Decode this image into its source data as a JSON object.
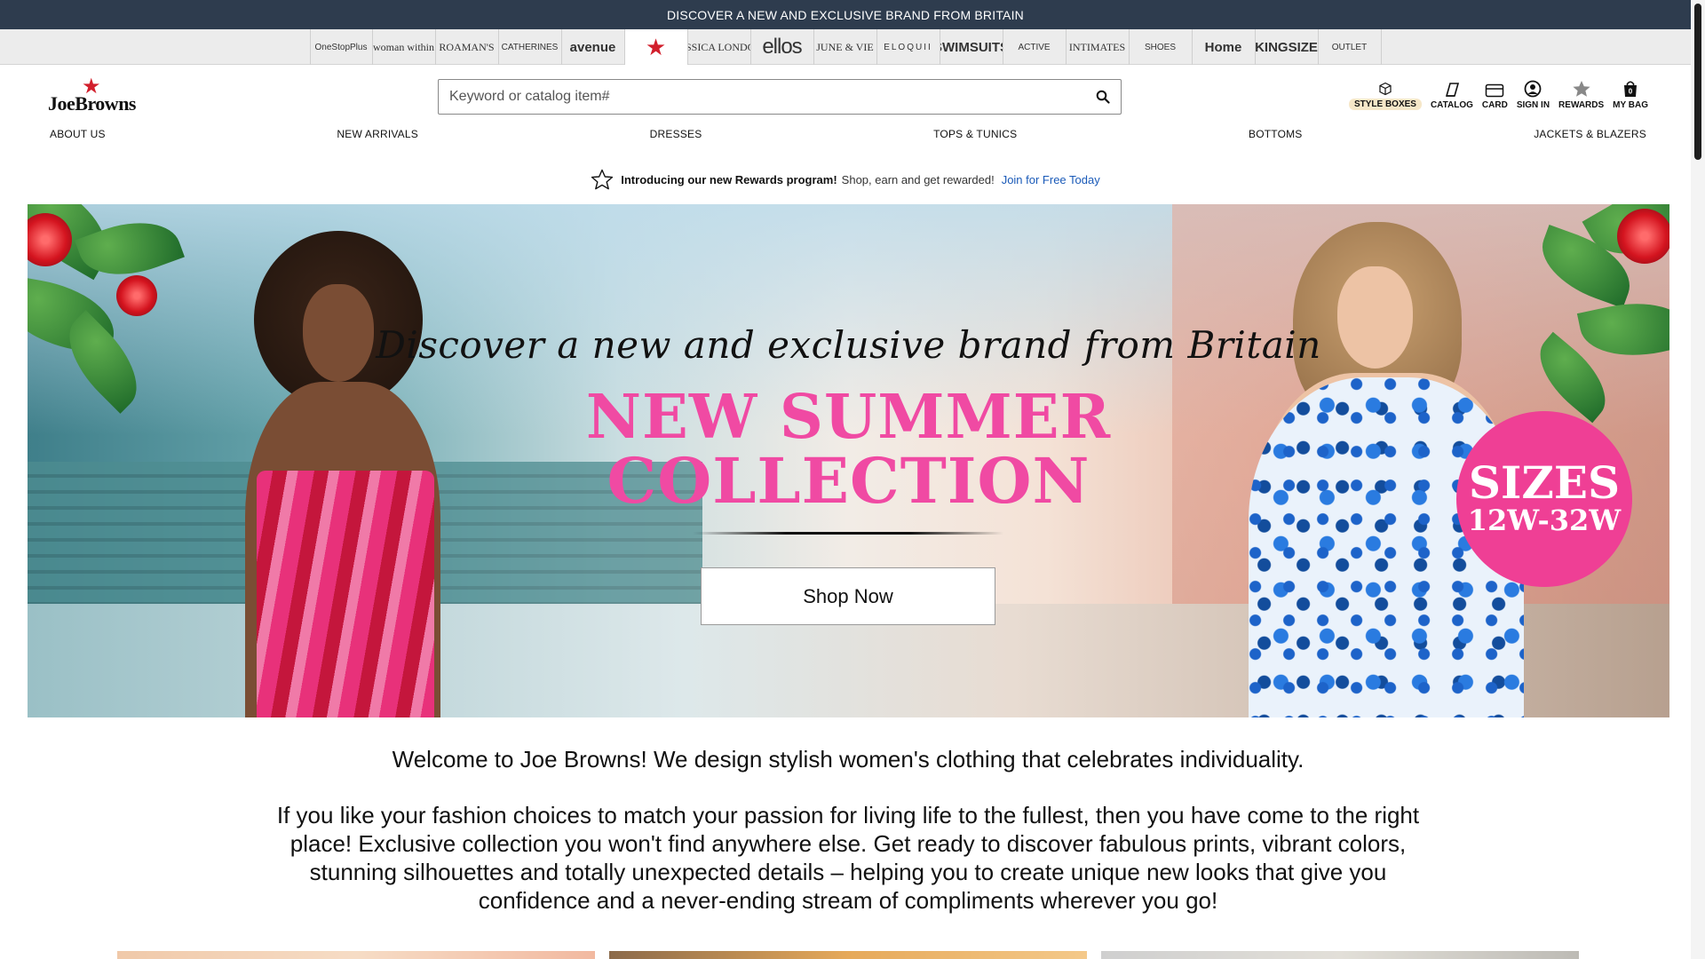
{
  "promo_bar": {
    "text": "DISCOVER A NEW AND EXCLUSIVE BRAND FROM BRITAIN"
  },
  "brand_strip": [
    {
      "label": "OneStopPlus",
      "style": "plain"
    },
    {
      "label": "woman within",
      "style": "serif"
    },
    {
      "label": "ROAMAN'S",
      "style": "serif"
    },
    {
      "label": "CATHERINES",
      "style": "plain"
    },
    {
      "label": "avenue",
      "style": "bold"
    },
    {
      "label": "★",
      "style": "star",
      "active": true
    },
    {
      "label": "JESSICA LONDON",
      "style": "serif"
    },
    {
      "label": "ellos",
      "style": "big"
    },
    {
      "label": "JUNE & VIE",
      "style": "serif"
    },
    {
      "label": "ELOQUII",
      "style": "spaced"
    },
    {
      "label": "SWIMSUITS",
      "style": "bold"
    },
    {
      "label": "ACTIVE",
      "style": "plain"
    },
    {
      "label": "INTIMATES",
      "style": "serif"
    },
    {
      "label": "SHOES",
      "style": "plain"
    },
    {
      "label": "Home",
      "style": "bold"
    },
    {
      "label": "KINGSIZE",
      "style": "bold"
    },
    {
      "label": "OUTLET",
      "style": "plain"
    }
  ],
  "header": {
    "logo_text": "JoeBrowns",
    "search_placeholder": "Keyword or catalog item#",
    "utilities": [
      {
        "label": "STYLE BOXES",
        "icon": "box-icon"
      },
      {
        "label": "CATALOG",
        "icon": "catalog-icon"
      },
      {
        "label": "CARD",
        "icon": "card-icon"
      },
      {
        "label": "SIGN IN",
        "icon": "user-icon"
      },
      {
        "label": "REWARDS",
        "icon": "star-icon"
      },
      {
        "label": "MY BAG",
        "icon": "bag-icon"
      }
    ]
  },
  "nav": [
    "ABOUT US",
    "NEW ARRIVALS",
    "DRESSES",
    "TOPS & TUNICS",
    "BOTTOMS",
    "JACKETS & BLAZERS"
  ],
  "rewards_banner": {
    "bold": "Introducing our new Rewards program!",
    "text": "Shop, earn and get rewarded!",
    "link": "Join for Free Today"
  },
  "hero": {
    "script": "Discover a new and exclusive brand from Britain",
    "title_line1": "NEW SUMMER",
    "title_line2": "COLLECTION",
    "cta": "Shop Now",
    "badge_line1": "SIZES",
    "badge_line2": "12W-32W",
    "accent_color": "#f04aa3"
  },
  "welcome": "Welcome to Joe Browns! We design stylish women's clothing that celebrates individuality.",
  "intro": "If you like your fashion choices to match your passion for living life to the fullest, then you have come to the right place! Exclusive collection you won't find anywhere else. Get ready to discover fabulous prints, vibrant colors, stunning silhouettes and totally unexpected details – helping you to create unique new looks that give you confidence and a never-ending stream of compliments wherever you go!"
}
